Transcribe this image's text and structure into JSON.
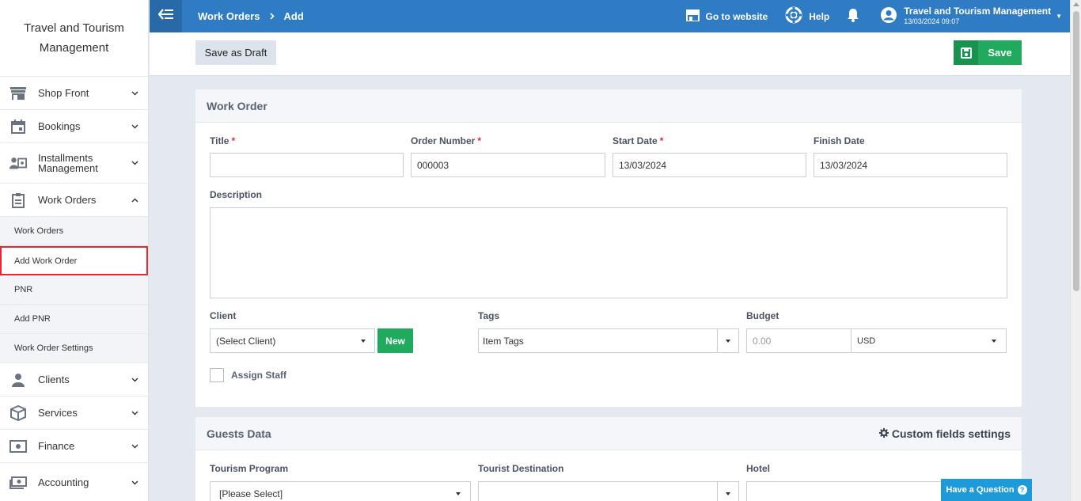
{
  "brand": {
    "title": "Travel and Tourism Management"
  },
  "sidebar": {
    "items": [
      {
        "label": "Shop Front",
        "icon": "storefront-icon"
      },
      {
        "label": "Bookings",
        "icon": "calendar-icon"
      },
      {
        "label": "Installments Management",
        "icon": "installments-icon"
      },
      {
        "label": "Work Orders",
        "icon": "clipboard-icon"
      },
      {
        "label": "Clients",
        "icon": "users-icon"
      },
      {
        "label": "Services",
        "icon": "box-icon"
      },
      {
        "label": "Finance",
        "icon": "cash-icon"
      },
      {
        "label": "Accounting",
        "icon": "money-icon"
      }
    ],
    "submenu": [
      {
        "label": "Work Orders"
      },
      {
        "label": "Add Work Order"
      },
      {
        "label": "PNR"
      },
      {
        "label": "Add PNR"
      },
      {
        "label": "Work Order Settings"
      }
    ]
  },
  "topbar": {
    "breadcrumb": [
      "Work Orders",
      "Add"
    ],
    "go_to_website": "Go to website",
    "help": "Help",
    "user_name": "Travel and Tourism Management",
    "user_time": "13/03/2024 09:07"
  },
  "actions": {
    "draft": "Save as Draft",
    "save": "Save"
  },
  "work_order": {
    "heading": "Work Order",
    "title_label": "Title",
    "title_value": "",
    "order_number_label": "Order Number",
    "order_number_value": "000003",
    "start_date_label": "Start Date",
    "start_date_value": "13/03/2024",
    "finish_date_label": "Finish Date",
    "finish_date_value": "13/03/2024",
    "description_label": "Description",
    "client_label": "Client",
    "client_value": "(Select Client)",
    "new_button": "New",
    "tags_label": "Tags",
    "tags_placeholder": "Item Tags",
    "budget_label": "Budget",
    "budget_placeholder": "0.00",
    "currency_value": "USD",
    "assign_staff_label": "Assign Staff",
    "required_mark": "*"
  },
  "guests": {
    "heading": "Guests Data",
    "custom_fields": "Custom fields settings",
    "tourism_program_label": "Tourism Program",
    "tourism_program_value": "[Please Select]",
    "tourist_destination_label": "Tourist Destination",
    "hotel_label": "Hotel"
  },
  "help_widget": {
    "label": "Have a Question",
    "mark": "?"
  },
  "colors": {
    "primary": "#2f7cc4",
    "success": "#1faa5e",
    "danger": "#e02b35"
  }
}
